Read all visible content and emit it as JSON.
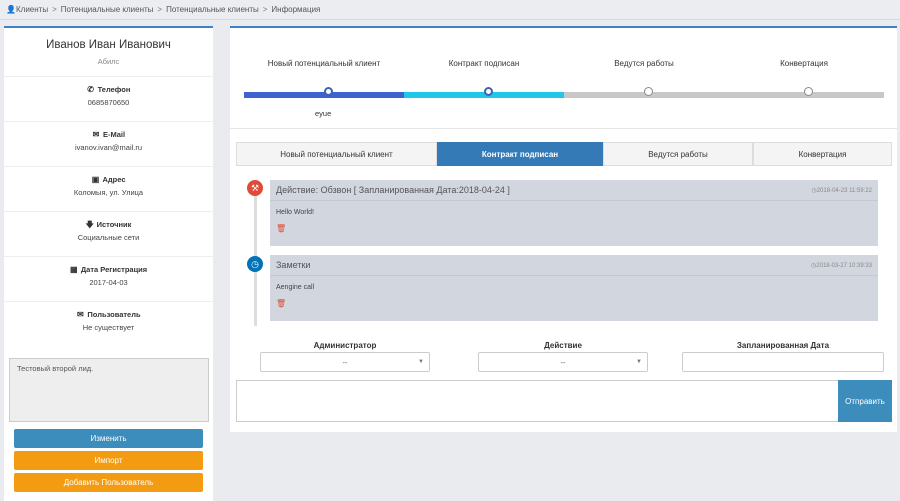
{
  "breadcrumb": {
    "items": [
      "Клиенты",
      "Потенциальные клиенты",
      "Потенциальные клиенты",
      "Информация"
    ],
    "separator": ">"
  },
  "profile": {
    "name": "Иванов Иван Иванович",
    "company": "Абилс",
    "phone_label": "Телефон",
    "phone": "0685870650",
    "email_label": "E-Mail",
    "email": "ivanov.ivan@mail.ru",
    "address_label": "Адрес",
    "address": "Коломыя, ул. Улица",
    "source_label": "Источник",
    "source": "Социальные сети",
    "reg_label": "Дата Регистрация",
    "reg_date": "2017-04-03",
    "user_label": "Пользователь",
    "user": "Не существует",
    "note": "Тестовый второй лид.",
    "btn_edit": "Изменить",
    "btn_import": "Импорт",
    "btn_add_user": "Добавить Пользователь"
  },
  "progress": {
    "steps": [
      "Новый потенциальный клиент",
      "Контракт подписан",
      "Ведутся работы",
      "Конвертация"
    ],
    "colors": [
      "#3c63d0",
      "#1ec8e6",
      "#c8c8c8",
      "#c8c8c8"
    ],
    "sub": "eyue",
    "current_step": 2
  },
  "tabs": [
    "Новый потенциальный клиент",
    "Контракт подписан",
    "Ведутся работы",
    "Конвертация"
  ],
  "active_tab": 1,
  "timeline": [
    {
      "title": "Действие: Обзвон [ Запланированная Дата:2018-04-24 ]",
      "time": "2018-04-23 11:59:22",
      "body": "Hello World!",
      "icon": "wrench-icon",
      "color": "#dd4b39"
    },
    {
      "title": "Заметки",
      "time": "2018-03-27 10:39:33",
      "body": "Aengine call",
      "icon": "info-icon",
      "color": "#0073b7"
    }
  ],
  "form": {
    "admin_label": "Администратор",
    "admin_value": "--",
    "action_label": "Действие",
    "action_value": "--",
    "date_label": "Запланированная Дата",
    "send": "Отправить"
  }
}
